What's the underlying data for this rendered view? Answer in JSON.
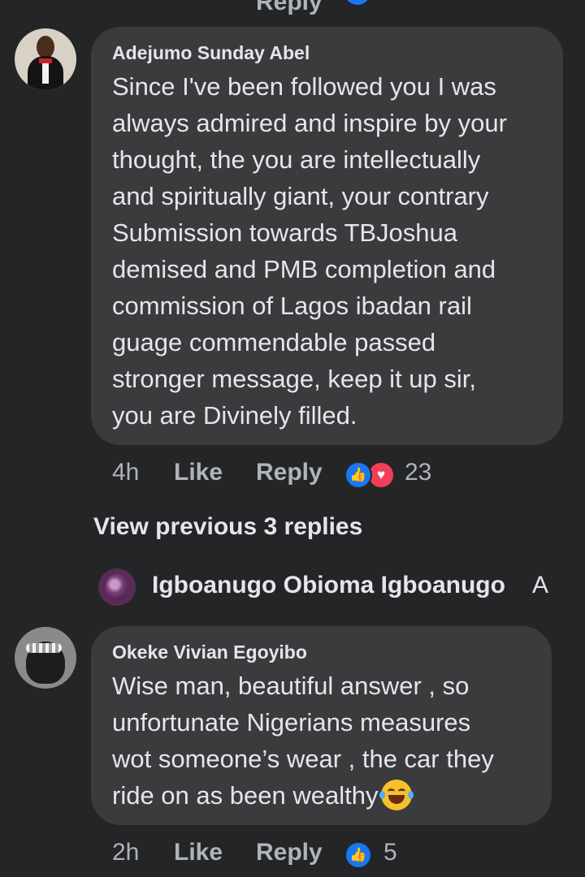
{
  "top_partial": {
    "reply_label": "Reply"
  },
  "comments": [
    {
      "author": "Adejumo Sunday Abel",
      "text": "Since I've been followed you  I was\nalways admired and inspire by your\nthought, the you are intellectually\nand spiritually giant, your contrary\nSubmission towards TBJoshua\ndemised and PMB completion and\ncommission of Lagos ibadan rail\nguage commendable passed\nstronger message, keep it up sir,\nyou are Divinely  filled.",
      "time": "4h",
      "like_label": "Like",
      "reply_label": "Reply",
      "reaction_count": "23",
      "reactions": [
        "like-icon",
        "love-icon"
      ]
    },
    {
      "author": "Okeke Vivian Egoyibo",
      "text": "Wise man, beautiful answer ,  so\nunfortunate Nigerians measures\nwot someone’s wear , the car they\nride on as been wealthy",
      "emoji": "laughing-tears-emoji",
      "time": "2h",
      "like_label": "Like",
      "reply_label": "Reply",
      "reaction_count": "5",
      "reactions": [
        "like-icon"
      ]
    }
  ],
  "view_previous_label": "View previous 3 replies",
  "reply_preview": {
    "author": "Igboanugo Obioma Igboanugo",
    "text_start": "A"
  },
  "colors": {
    "background": "#242526",
    "bubble": "#3a3b3c",
    "text": "#e4e6eb",
    "muted": "#b0b3b8",
    "like_blue": "#1877f2",
    "love_red": "#f33e58"
  }
}
